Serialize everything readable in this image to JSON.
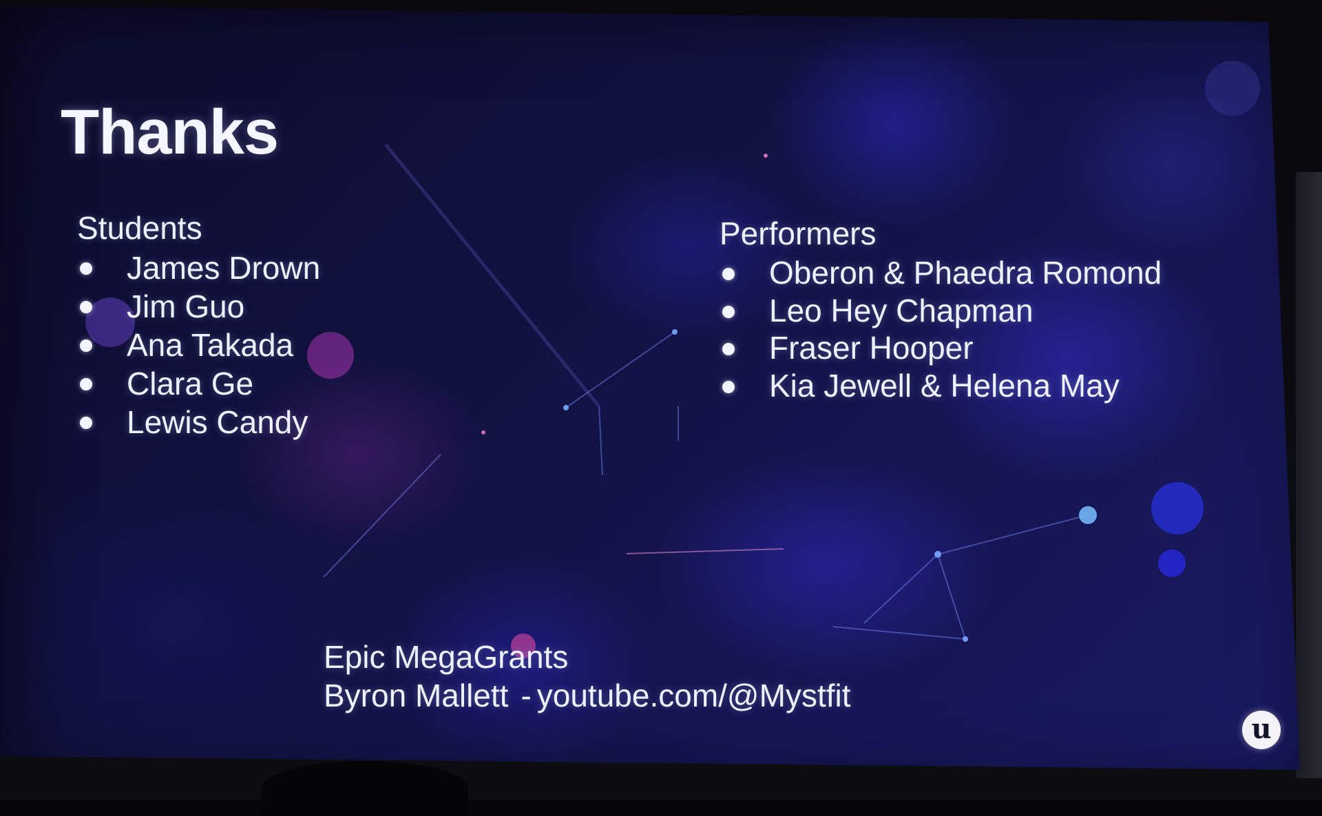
{
  "slide": {
    "title": "Thanks",
    "students": {
      "heading": "Students",
      "names": [
        "James Drown",
        "Jim Guo",
        "Ana Takada",
        "Clara Ge",
        "Lewis Candy"
      ]
    },
    "performers": {
      "heading": "Performers",
      "names": [
        "Oberon & Phaedra Romond",
        "Leo Hey Chapman",
        "Fraser Hooper",
        "Kia Jewell & Helena May"
      ]
    },
    "credits": {
      "grant": "Epic MegaGrants",
      "person": "Byron Mallett",
      "separator": "-",
      "channel": "youtube.com/@Mystfit"
    },
    "logo_icon": "unreal-engine-logo-icon",
    "logo_glyph": "u"
  },
  "colors": {
    "text": "#eef1ff",
    "background_deep": "#0c0c2c",
    "background_glow": "#2d2dc8"
  }
}
